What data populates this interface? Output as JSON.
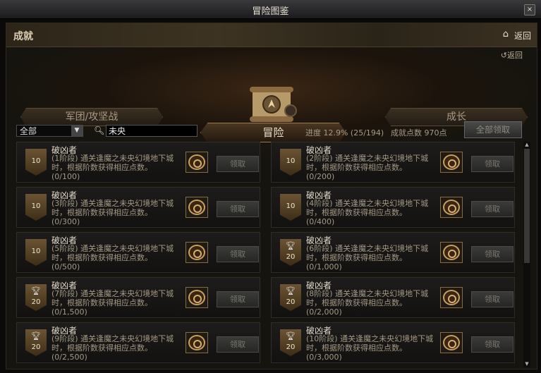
{
  "window": {
    "title": "冒险图鉴",
    "close_icon": "×"
  },
  "header": {
    "section_title": "成就",
    "home_icon": "⌂",
    "back_label": "返回"
  },
  "subback": {
    "icon": "↺",
    "label": "返回"
  },
  "tabs": {
    "left": "军团/攻坚战",
    "center": "冒险",
    "right": "成长"
  },
  "filter": {
    "select_value": "全部",
    "search_value": "未央",
    "progress_text": "进度 12.9% (25/194)",
    "points_text": "成就点数 970点",
    "claim_all_label": "全部领取"
  },
  "cards": [
    {
      "name": "破凶者",
      "desc": "(1阶段) 通关逢魔之未央幻境地下城时，根据阶数获得相应点数。",
      "progress": "(0/100)",
      "points": "10",
      "trophy": false,
      "claim": "领取"
    },
    {
      "name": "破凶者",
      "desc": "(2阶段) 通关逢魔之未央幻境地下城时，根据阶数获得相应点数。",
      "progress": "(0/200)",
      "points": "10",
      "trophy": false,
      "claim": "领取"
    },
    {
      "name": "破凶者",
      "desc": "(3阶段) 通关逢魔之未央幻境地下城时，根据阶数获得相应点数。",
      "progress": "(0/300)",
      "points": "10",
      "trophy": false,
      "claim": "领取"
    },
    {
      "name": "破凶者",
      "desc": "(4阶段) 通关逢魔之未央幻境地下城时，根据阶数获得相应点数。",
      "progress": "(0/400)",
      "points": "10",
      "trophy": false,
      "claim": "领取"
    },
    {
      "name": "破凶者",
      "desc": "(5阶段) 通关逢魔之未央幻境地下城时，根据阶数获得相应点数。",
      "progress": "(0/500)",
      "points": "10",
      "trophy": false,
      "claim": "领取"
    },
    {
      "name": "破凶者",
      "desc": "(6阶段) 通关逢魔之未央幻境地下城时，根据阶数获得相应点数。",
      "progress": "(0/1,000)",
      "points": "20",
      "trophy": true,
      "claim": "领取"
    },
    {
      "name": "破凶者",
      "desc": "(7阶段) 通关逢魔之未央幻境地下城时，根据阶数获得相应点数。",
      "progress": "(0/1,500)",
      "points": "20",
      "trophy": true,
      "claim": "领取"
    },
    {
      "name": "破凶者",
      "desc": "(8阶段) 通关逢魔之未央幻境地下城时，根据阶数获得相应点数。",
      "progress": "(0/2,000)",
      "points": "20",
      "trophy": true,
      "claim": "领取"
    },
    {
      "name": "破凶者",
      "desc": "(9阶段) 通关逢魔之未央幻境地下城时，根据阶数获得相应点数。",
      "progress": "(0/2,500)",
      "points": "20",
      "trophy": true,
      "claim": "领取"
    },
    {
      "name": "破凶者",
      "desc": "(10阶段) 通关逢魔之未央幻境地下城时，根据阶数获得相应点数。",
      "progress": "(0/3,000)",
      "points": "20",
      "trophy": true,
      "claim": "领取"
    }
  ],
  "icons": {
    "search": "search-icon",
    "trophy": "trophy-icon",
    "reward": "reward-medal-icon"
  }
}
